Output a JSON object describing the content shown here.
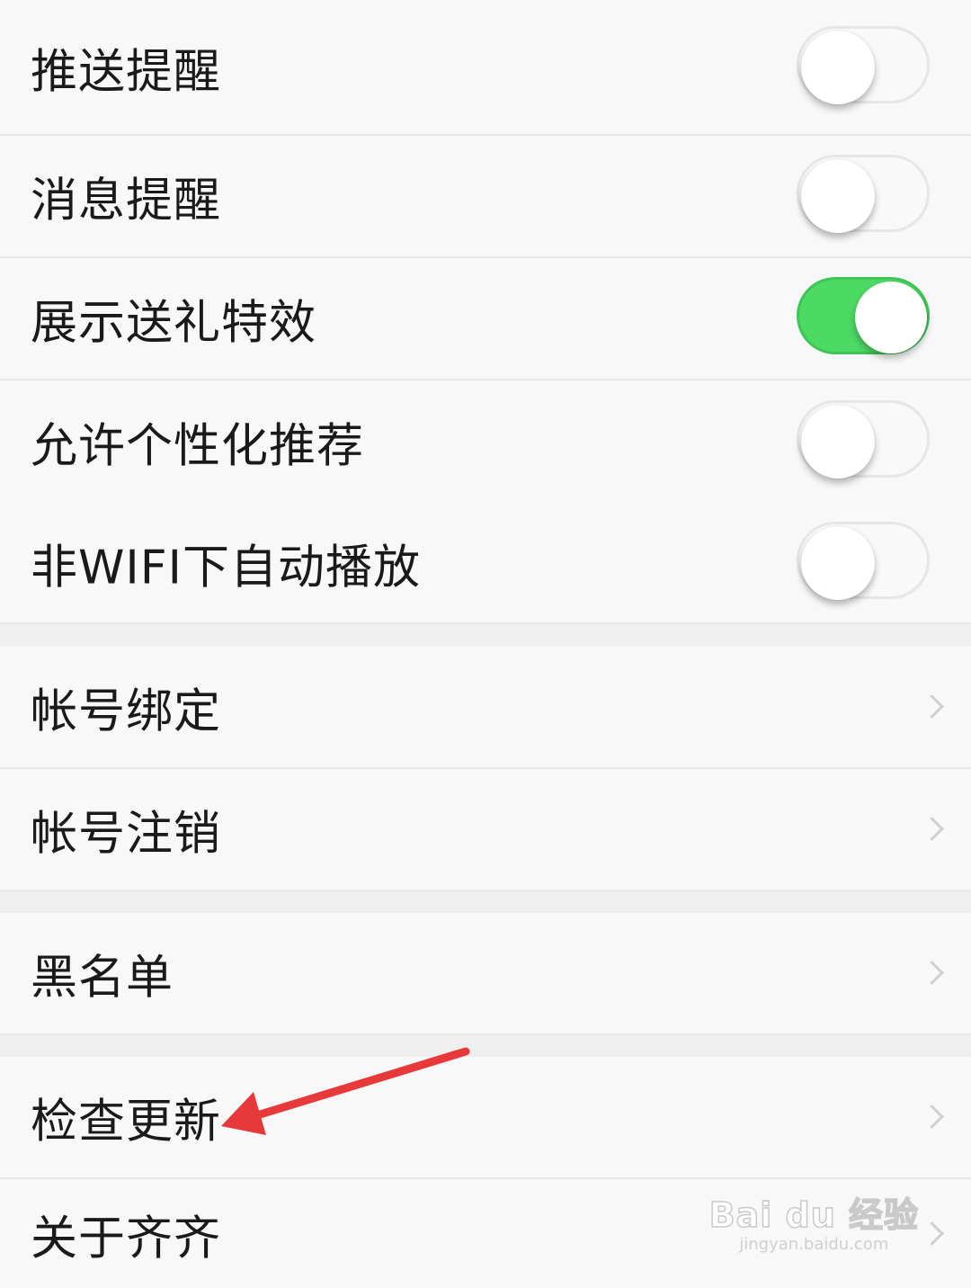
{
  "toggle_items": [
    {
      "label": "推送提醒",
      "on": false
    },
    {
      "label": "消息提醒",
      "on": false
    },
    {
      "label": "展示送礼特效",
      "on": true
    },
    {
      "label": "允许个性化推荐",
      "on": false
    },
    {
      "label": "非WIFI下自动播放",
      "on": false
    }
  ],
  "nav_items": [
    {
      "label": "帐号绑定"
    },
    {
      "label": "帐号注销"
    },
    {
      "label": "黑名单"
    },
    {
      "label": "检查更新"
    },
    {
      "label": "关于齐齐"
    }
  ],
  "colors": {
    "toggle_on": "#4cd964",
    "annotation_arrow": "#e8393a"
  },
  "watermark": {
    "logo_text": "Bai du 经验",
    "url": "jingyan.baidu.com"
  }
}
